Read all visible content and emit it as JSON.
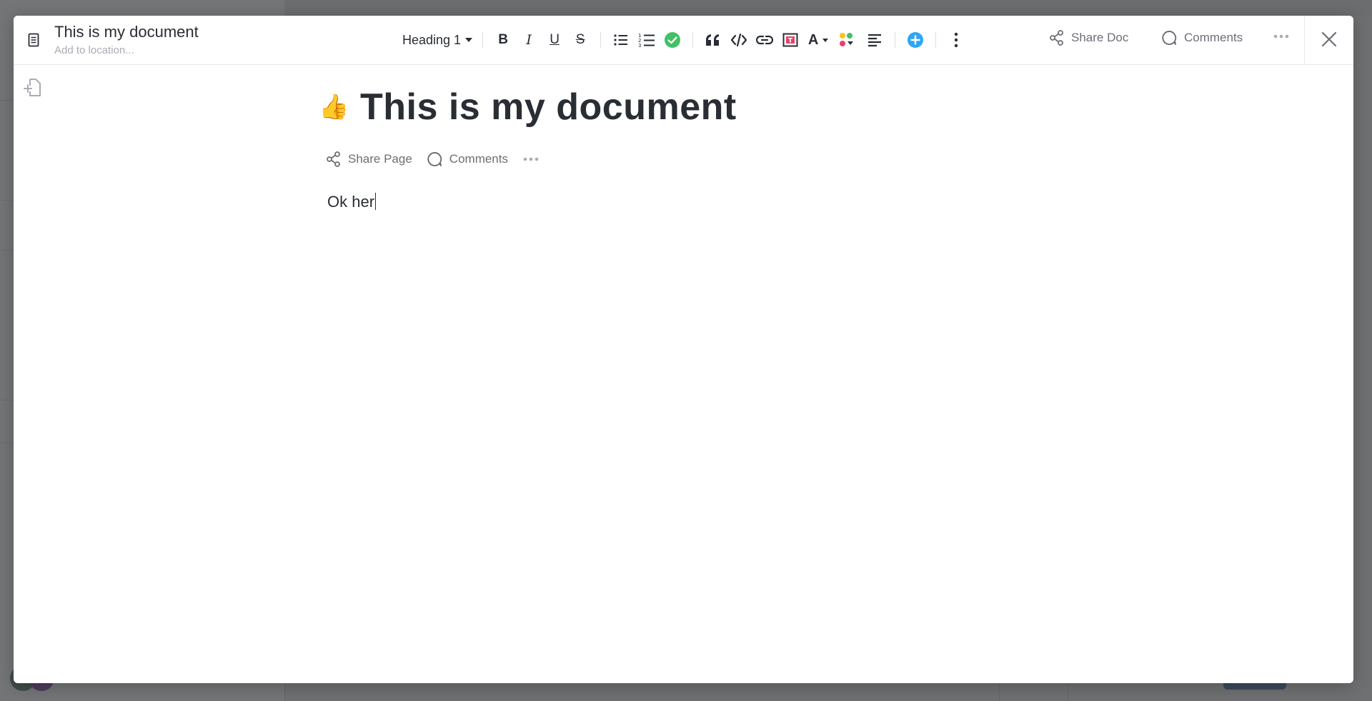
{
  "header": {
    "doc_title": "This is my document",
    "location_placeholder": "Add to location...",
    "heading_style": "Heading 1",
    "share_doc_label": "Share Doc",
    "comments_label": "Comments"
  },
  "toolbar": {
    "bold": "B",
    "italic": "I",
    "underline": "U",
    "strike": "S",
    "text_color_letter": "A"
  },
  "page": {
    "emoji": "👍",
    "title": "This is my document",
    "share_page_label": "Share Page",
    "comments_label": "Comments",
    "body_text": "Ok her"
  },
  "colors": {
    "accent_blue": "#2ea5f5",
    "check_green": "#3fc164"
  },
  "icons": {
    "doc": "doc-icon",
    "bullet_list": "bullet-list-icon",
    "numbered_list": "numbered-list-icon",
    "checklist": "checklist-icon",
    "quote": "quote-icon",
    "code": "code-icon",
    "link": "link-icon",
    "banner": "banner-icon",
    "text_color": "text-color-icon",
    "color_picker": "color-dots-icon",
    "align": "align-left-icon",
    "add": "plus-circle-icon",
    "more": "more-vertical-icon",
    "share": "share-icon",
    "comment": "comment-icon",
    "close": "close-icon",
    "add_page": "add-page-icon"
  }
}
